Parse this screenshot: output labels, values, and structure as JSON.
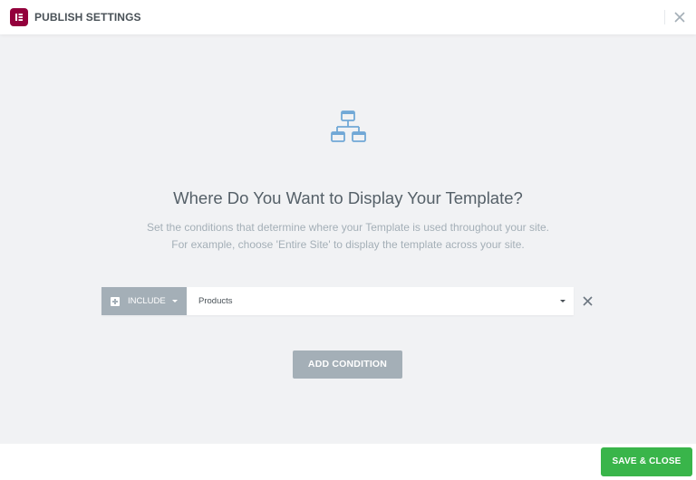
{
  "header": {
    "title": "PUBLISH SETTINGS",
    "logo_icon": "elementor-logo",
    "close_icon": "close-icon"
  },
  "main": {
    "icon": "sitemap-icon",
    "title": "Where Do You Want to Display Your Template?",
    "description_line1": "Set the conditions that determine where your Template is used throughout your site.",
    "description_line2": "For example, choose 'Entire Site' to display the template across your site."
  },
  "conditions": [
    {
      "type": "INCLUDE",
      "value": "Products"
    }
  ],
  "buttons": {
    "add_condition": "ADD CONDITION",
    "save_close": "SAVE & CLOSE"
  },
  "colors": {
    "brand": "#93003c",
    "accent_gray": "#a4afb7",
    "save_green": "#39b54a",
    "icon_blue": "#71a8d6"
  }
}
